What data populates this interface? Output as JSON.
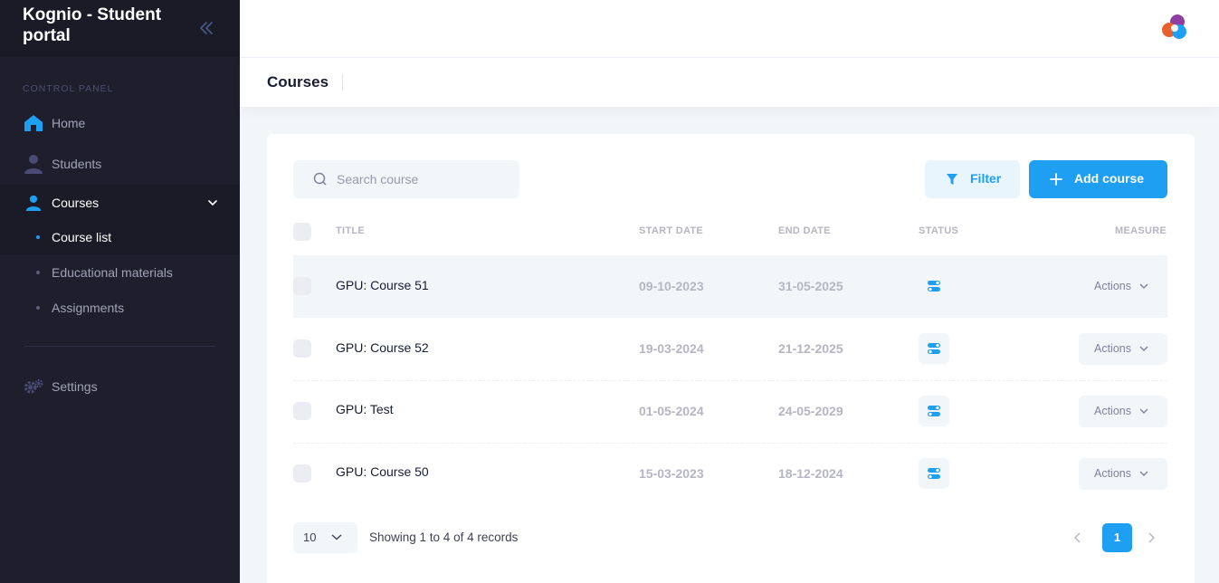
{
  "app": {
    "title": "Kognio - Student portal"
  },
  "sidebar": {
    "section_label": "CONTROL PANEL",
    "items": [
      {
        "label": "Home",
        "icon": "home-icon"
      },
      {
        "label": "Students",
        "icon": "user-icon"
      },
      {
        "label": "Courses",
        "icon": "user-icon",
        "expanded": true
      },
      {
        "label": "Settings",
        "icon": "gears-icon"
      }
    ],
    "sub_items": [
      {
        "label": "Course list",
        "active": true
      },
      {
        "label": "Educational materials"
      },
      {
        "label": "Assignments"
      }
    ]
  },
  "header": {
    "page_title": "Courses"
  },
  "toolbar": {
    "search_placeholder": "Search course",
    "filter_label": "Filter",
    "add_label": "Add course"
  },
  "table": {
    "columns": [
      "TITLE",
      "START DATE",
      "END DATE",
      "STATUS",
      "MEASURE"
    ],
    "rows": [
      {
        "title": "GPU: Course 51",
        "start": "09-10-2023",
        "end": "31-05-2025",
        "actions": "Actions"
      },
      {
        "title": "GPU: Course 52",
        "start": "19-03-2024",
        "end": "21-12-2025",
        "actions": "Actions"
      },
      {
        "title": "GPU: Test",
        "start": "01-05-2024",
        "end": "24-05-2029",
        "actions": "Actions"
      },
      {
        "title": "GPU: Course 50",
        "start": "15-03-2023",
        "end": "18-12-2024",
        "actions": "Actions"
      }
    ]
  },
  "pagination": {
    "page_size": "10",
    "summary": "Showing 1 to 4 of 4 records",
    "current_page": "1"
  },
  "colors": {
    "accent": "#1e9ff2",
    "sidebar_bg": "#1e1e2d"
  }
}
